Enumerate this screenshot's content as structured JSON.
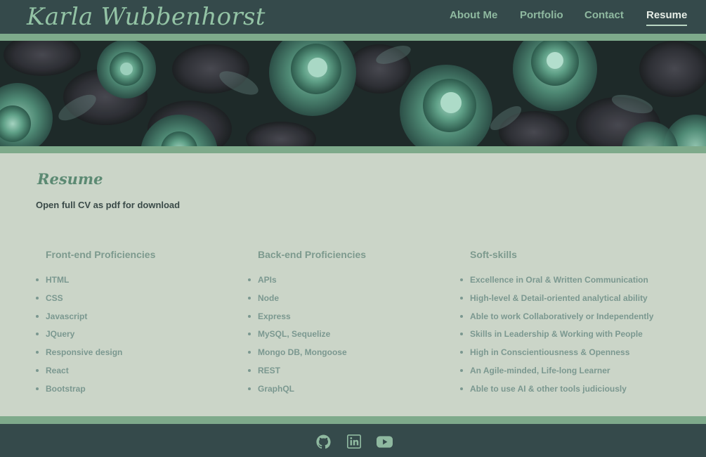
{
  "header": {
    "brand": "Karla Wubbenhorst",
    "nav": [
      {
        "label": "About Me"
      },
      {
        "label": "Portfolio"
      },
      {
        "label": "Contact"
      },
      {
        "label": "Resume",
        "active": true
      }
    ]
  },
  "hero": {
    "image": "succulent-plants-photo"
  },
  "resume": {
    "title": "Resume",
    "cv_link": "Open full CV as pdf for download",
    "columns": [
      {
        "title": "Front-end Proficiencies",
        "items": [
          "HTML",
          "CSS",
          "Javascript",
          "JQuery",
          "Responsive design",
          "React",
          "Bootstrap"
        ]
      },
      {
        "title": "Back-end Proficiencies",
        "items": [
          "APIs",
          "Node",
          "Express",
          "MySQL, Sequelize",
          "Mongo DB, Mongoose",
          "REST",
          "GraphQL"
        ]
      },
      {
        "title": "Soft-skills",
        "items": [
          "Excellence in Oral & Written Communication",
          "High-level & Detail-oriented analytical ability",
          "Able to work Collaboratively or Independently",
          "Skills in Leadership & Working with People",
          "High in Conscientiousness & Openness",
          "An Agile-minded, Life-long Learner",
          "Able to use AI & other tools judiciously"
        ]
      }
    ]
  },
  "footer": {
    "icons": [
      "github-icon",
      "linkedin-icon",
      "youtube-icon"
    ]
  },
  "colors": {
    "header_bg": "#354a4b",
    "accent_band": "#7eaa8b",
    "content_bg": "#cbd5c8",
    "brand": "#93c3a5",
    "nav_text": "#8fb9a0",
    "nav_active": "#e6ede6"
  }
}
